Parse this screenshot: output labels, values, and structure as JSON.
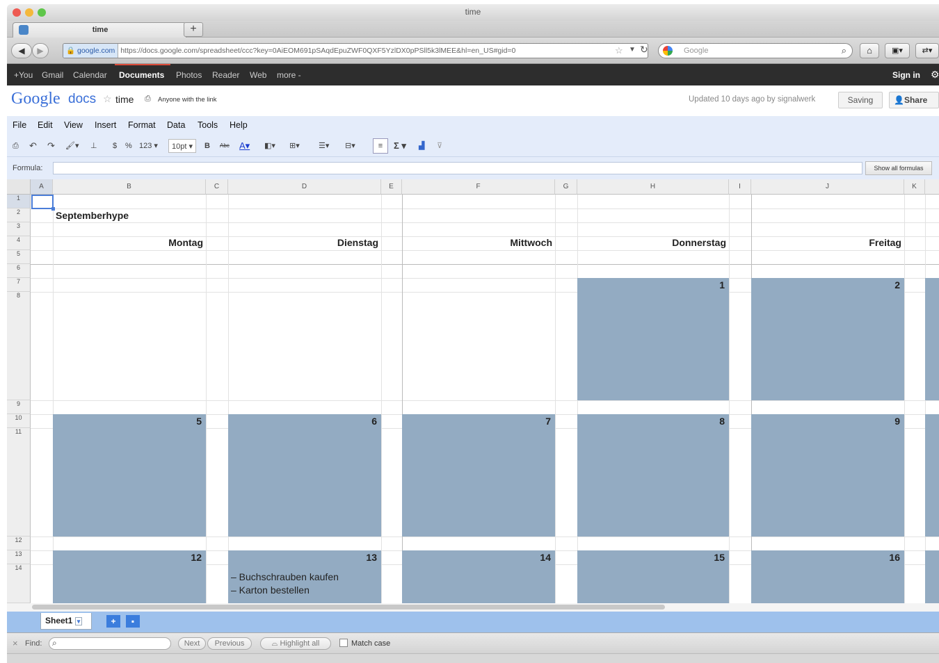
{
  "window": {
    "title": "time"
  },
  "browser": {
    "tab_title": "time",
    "new_tab": "+",
    "domain": "google.com",
    "url": "https://docs.google.com/spreadsheet/ccc?key=0AiEOM691pSAqdEpuZWF0QXF5YzlDX0pPSll5k3lMEE&hl=en_US#gid=0",
    "search_engine": "Google",
    "search_placeholder": "Google"
  },
  "gbar": {
    "links": [
      "+You",
      "Gmail",
      "Calendar",
      "Documents",
      "Photos",
      "Reader",
      "Web",
      "more -"
    ],
    "active": "Documents",
    "sign_in": "Sign in"
  },
  "doc": {
    "logo_google": "Google",
    "logo_docs": "docs",
    "title": "time",
    "sharing": "Anyone with the link",
    "updated": "Updated 10 days ago by signalwerk",
    "saving": "Saving",
    "share": "Share"
  },
  "menu": [
    "File",
    "Edit",
    "View",
    "Insert",
    "Format",
    "Data",
    "Tools",
    "Help"
  ],
  "toolbar": {
    "currency": "$",
    "percent": "%",
    "number": "123 ▾",
    "font_size": "10pt ▾",
    "bold": "B",
    "strike": "Abc",
    "sigma": "Σ ▾"
  },
  "formula": {
    "label": "Formula:",
    "value": "",
    "show_all": "Show all formulas"
  },
  "columns": [
    "A",
    "B",
    "C",
    "D",
    "E",
    "F",
    "G",
    "H",
    "I",
    "J",
    "K"
  ],
  "rows": [
    "1",
    "2",
    "3",
    "4",
    "5",
    "6",
    "7",
    "8",
    "9",
    "10",
    "11",
    "12",
    "13",
    "14"
  ],
  "sheet": {
    "title": "Septemberhype",
    "weekdays": [
      "Montag",
      "Dienstag",
      "Mittwoch",
      "Donnerstag",
      "Freitag"
    ],
    "week1": [
      "1",
      "2"
    ],
    "week2": [
      "5",
      "6",
      "7",
      "8",
      "9"
    ],
    "week3": [
      "12",
      "13",
      "14",
      "15",
      "16"
    ],
    "notes": [
      "– Buchschrauben kaufen",
      "– Karton bestellen"
    ]
  },
  "sheet_tab": {
    "name": "Sheet1",
    "add": "+"
  },
  "find": {
    "close": "×",
    "label": "Find:",
    "next": "Next",
    "previous": "Previous",
    "highlight": "Highlight all",
    "match_case": "Match case"
  },
  "colors": {
    "day_fill": "#93abc2",
    "gbar": "#2d2d2d",
    "menu_bg": "#e4ecfa",
    "sheet_tabs_bg": "#9ec1ec"
  }
}
